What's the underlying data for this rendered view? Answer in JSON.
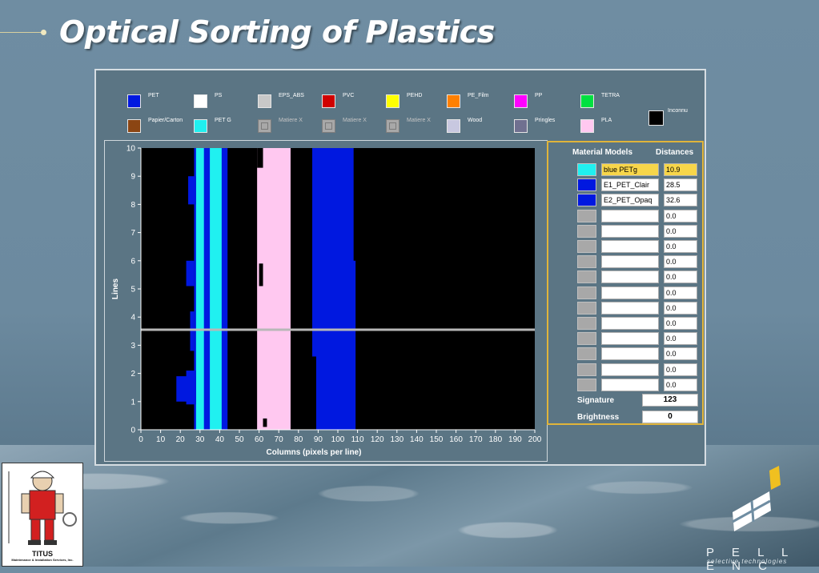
{
  "slide": {
    "title": "Optical Sorting of Plastics"
  },
  "branding": {
    "left_logo_name": "TITUS",
    "left_logo_tagline": "Maintenance & Installation Services, Inc.",
    "right_logo_name": "P E L L E N C",
    "right_logo_tagline": "selective technologies"
  },
  "legend": {
    "row1": [
      {
        "label": "PET",
        "color": "#0018e0"
      },
      {
        "label": "PS",
        "color": "#ffffff"
      },
      {
        "label": "EPS_ABS",
        "color": "#c8c8c8"
      },
      {
        "label": "PVC",
        "color": "#d00000"
      },
      {
        "label": "PEHD",
        "color": "#ffff00"
      },
      {
        "label": "PE_Film",
        "color": "#ff8000"
      },
      {
        "label": "PP",
        "color": "#ff00ff"
      },
      {
        "label": "TETRA",
        "color": "#00e040"
      }
    ],
    "row2": [
      {
        "label": "Papier/Carton",
        "color": "#8b4513",
        "disabled": false
      },
      {
        "label": "PET G",
        "color": "#20f0f0",
        "disabled": false
      },
      {
        "label": "Matiere X",
        "color": "#a8a8a8",
        "disabled": true
      },
      {
        "label": "Matiere X",
        "color": "#a8a8a8",
        "disabled": true
      },
      {
        "label": "Matiere X",
        "color": "#a8a8a8",
        "disabled": true
      },
      {
        "label": "Wood",
        "color": "#c8c8e0",
        "disabled": false
      },
      {
        "label": "Pringles",
        "color": "#707090",
        "disabled": false
      },
      {
        "label": "PLA",
        "color": "#ffc8f0",
        "disabled": false
      }
    ],
    "extra": {
      "label": "Inconnu",
      "color": "#000000"
    }
  },
  "chart_data": {
    "type": "heatmap",
    "xlabel": "Columns (pixels per line)",
    "ylabel": "Lines",
    "xlim": [
      0,
      200
    ],
    "ylim": [
      0,
      10
    ],
    "xticks": [
      0,
      10,
      20,
      30,
      40,
      50,
      60,
      70,
      80,
      90,
      100,
      110,
      120,
      130,
      140,
      150,
      160,
      170,
      180,
      190,
      200
    ],
    "yticks": [
      0,
      1,
      2,
      3,
      4,
      5,
      6,
      7,
      8,
      9,
      10
    ],
    "background_color": "#000000",
    "cursor_line_y": 3.55,
    "cursor_color": "#b8b8b8",
    "bands": [
      {
        "material": "PET",
        "color": "#0018e0",
        "x0": 27,
        "x1": 44
      },
      {
        "material": "PET G",
        "color": "#20f0f0",
        "x0": 28,
        "x1": 41
      },
      {
        "material": "PET",
        "color": "#0018e0",
        "x0": 32,
        "x1": 35
      },
      {
        "material": "PLA",
        "color": "#ffc8f0",
        "x0": 59,
        "x1": 76
      },
      {
        "material": "PET",
        "color": "#0018e0",
        "x0": 87,
        "x1": 109
      }
    ],
    "notches": [
      {
        "color": "#0018e0",
        "x0": 18,
        "x1": 28,
        "y0": 1.0,
        "y1": 1.9
      },
      {
        "color": "#0018e0",
        "x0": 23,
        "x1": 28,
        "y0": 0.9,
        "y1": 2.1
      },
      {
        "color": "#0018e0",
        "x0": 24,
        "x1": 28,
        "y0": 8.0,
        "y1": 9.0
      },
      {
        "color": "#0018e0",
        "x0": 23,
        "x1": 27,
        "y0": 5.1,
        "y1": 6.0
      },
      {
        "color": "#0018e0",
        "x0": 25,
        "x1": 27,
        "y0": 2.8,
        "y1": 4.2
      },
      {
        "color": "#000000",
        "x0": 60,
        "x1": 62,
        "y0": 5.1,
        "y1": 5.9
      },
      {
        "color": "#000000",
        "x0": 62,
        "x1": 64,
        "y0": 0.1,
        "y1": 0.4
      },
      {
        "color": "#000000",
        "x0": 59,
        "x1": 62,
        "y0": 9.3,
        "y1": 10.0
      },
      {
        "color": "#000000",
        "x0": 87,
        "x1": 89,
        "y0": 0.0,
        "y1": 2.6
      },
      {
        "color": "#000000",
        "x0": 108,
        "x1": 110,
        "y0": 6.0,
        "y1": 10.0
      }
    ]
  },
  "panel": {
    "material_models_header": "Material Models",
    "distances_header": "Distances",
    "models": [
      {
        "name": "blue PETg",
        "distance": "10.9",
        "color": "#20f0f0",
        "highlight": true
      },
      {
        "name": "E1_PET_Clair",
        "distance": "28.5",
        "color": "#0018e0",
        "highlight": false
      },
      {
        "name": "E2_PET_Opaq",
        "distance": "32.6",
        "color": "#0018e0",
        "highlight": false
      },
      {
        "name": "",
        "distance": "0.0",
        "color": "#a8a8a8",
        "highlight": false
      },
      {
        "name": "",
        "distance": "0.0",
        "color": "#a8a8a8",
        "highlight": false
      },
      {
        "name": "",
        "distance": "0.0",
        "color": "#a8a8a8",
        "highlight": false
      },
      {
        "name": "",
        "distance": "0.0",
        "color": "#a8a8a8",
        "highlight": false
      },
      {
        "name": "",
        "distance": "0.0",
        "color": "#a8a8a8",
        "highlight": false
      },
      {
        "name": "",
        "distance": "0.0",
        "color": "#a8a8a8",
        "highlight": false
      },
      {
        "name": "",
        "distance": "0.0",
        "color": "#a8a8a8",
        "highlight": false
      },
      {
        "name": "",
        "distance": "0.0",
        "color": "#a8a8a8",
        "highlight": false
      },
      {
        "name": "",
        "distance": "0.0",
        "color": "#a8a8a8",
        "highlight": false
      },
      {
        "name": "",
        "distance": "0.0",
        "color": "#a8a8a8",
        "highlight": false
      },
      {
        "name": "",
        "distance": "0.0",
        "color": "#a8a8a8",
        "highlight": false
      },
      {
        "name": "",
        "distance": "0.0",
        "color": "#a8a8a8",
        "highlight": false
      }
    ],
    "signature_label": "Signature",
    "signature_value": "123",
    "brightness_label": "Brightness",
    "brightness_value": "0"
  }
}
